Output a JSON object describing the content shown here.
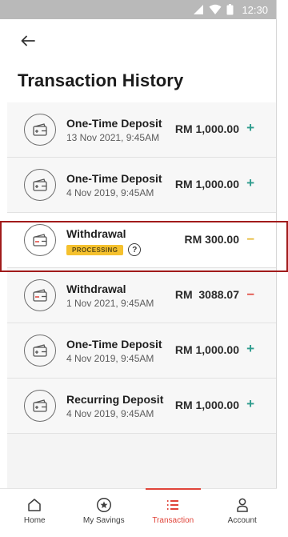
{
  "status_bar": {
    "time": "12:30"
  },
  "page": {
    "title": "Transaction History"
  },
  "transactions": [
    {
      "title": "One-Time Deposit",
      "date": "13 Nov 2021, 9:45AM",
      "amount": "RM 1,000.00",
      "sign": "+",
      "kind": "deposit"
    },
    {
      "title": "One-Time Deposit",
      "date": "4 Nov 2019, 9:45AM",
      "amount": "RM 1,000.00",
      "sign": "+",
      "kind": "deposit"
    },
    {
      "title": "Withdrawal",
      "status": "PROCESSING",
      "help": "?",
      "amount": "RM 300.00",
      "sign": "–",
      "kind": "withdrawal"
    },
    {
      "title": "Withdrawal",
      "date": "1 Nov 2021, 9:45AM",
      "amount": "RM  3088.07",
      "sign": "–",
      "kind": "withdrawal"
    },
    {
      "title": "One-Time Deposit",
      "date": "4 Nov 2019, 9:45AM",
      "amount": "RM 1,000.00",
      "sign": "+",
      "kind": "deposit"
    },
    {
      "title": "Recurring Deposit",
      "date": "4 Nov 2019, 9:45AM",
      "amount": "RM 1,000.00",
      "sign": "+",
      "kind": "deposit"
    }
  ],
  "bottom_nav": [
    {
      "label": "Home",
      "icon": "home-icon"
    },
    {
      "label": "My Savings",
      "icon": "star-circle-icon"
    },
    {
      "label": "Transaction",
      "icon": "list-icon",
      "active": true
    },
    {
      "label": "Account",
      "icon": "person-icon"
    }
  ],
  "colors": {
    "accent": "#e0443a",
    "plus": "#2e9c8e",
    "pending": "#e5b52a",
    "badge": "#f5c12e",
    "highlight_border": "#a11b1b"
  }
}
